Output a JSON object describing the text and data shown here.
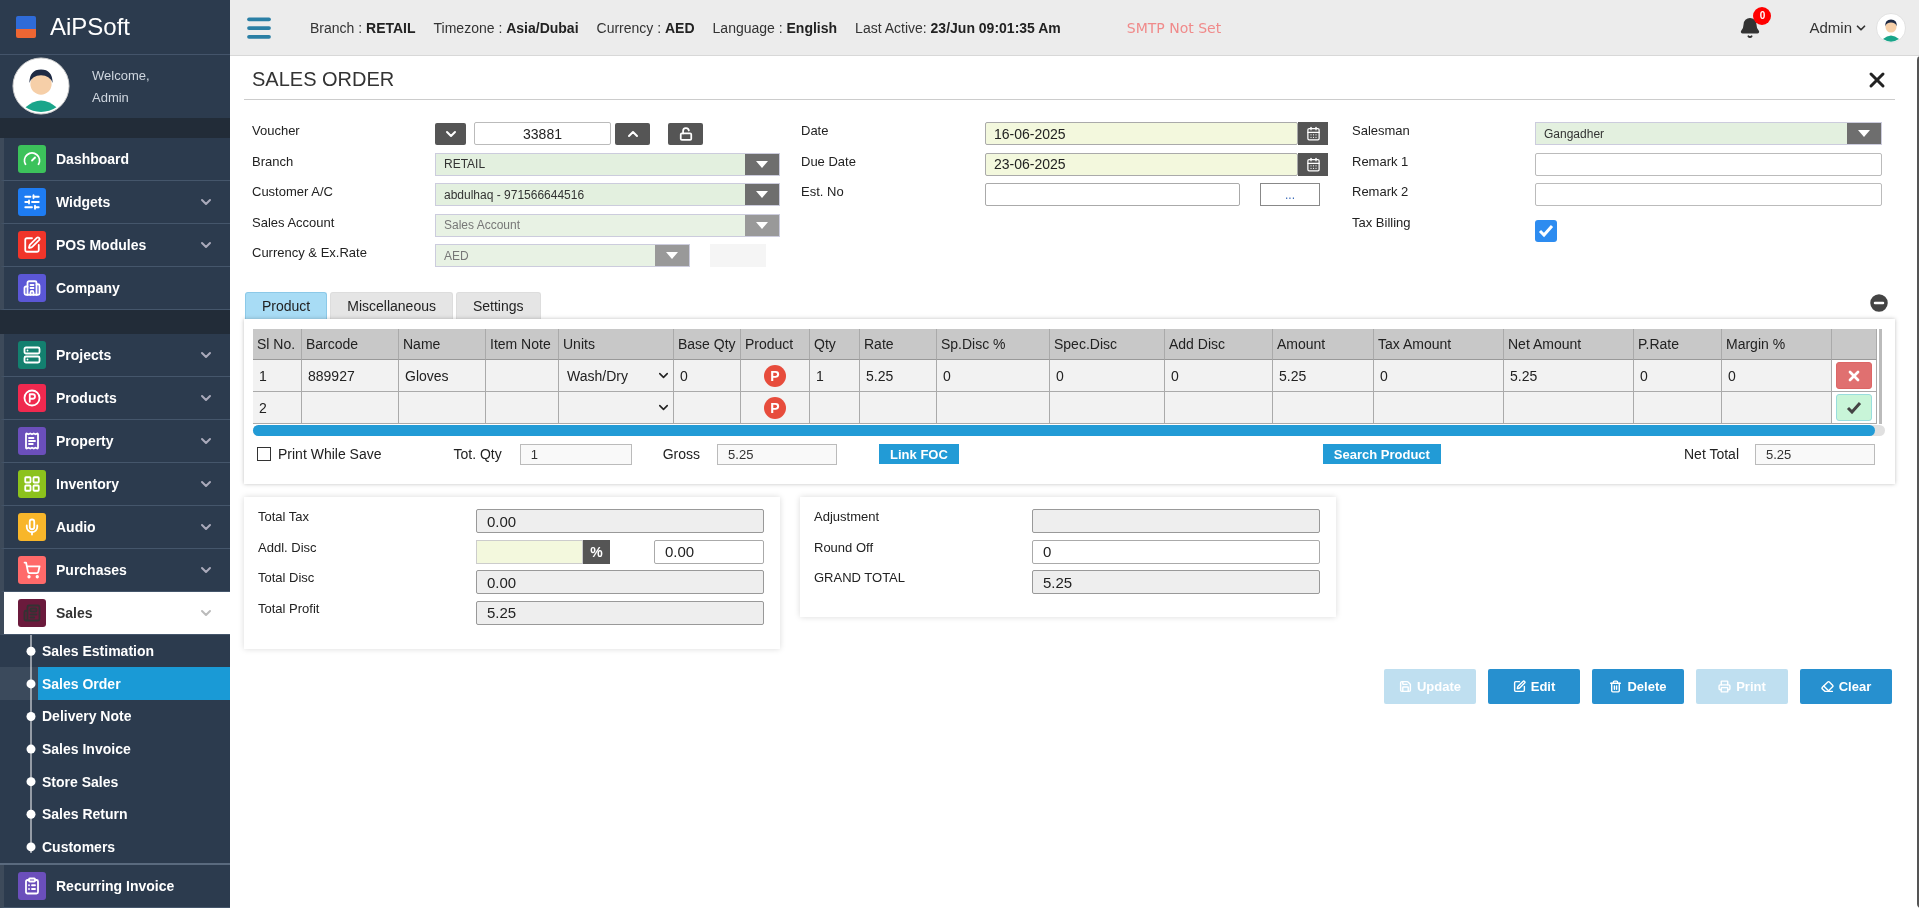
{
  "sidebar": {
    "brand": "AiPSoft",
    "welcome": "Welcome,",
    "user": "Admin",
    "groups": [
      {
        "items": [
          {
            "label": "Dashboard",
            "color": "#3cc25b",
            "expandable": false,
            "expanded": false
          },
          {
            "label": "Widgets",
            "color": "#1e7cf2",
            "expandable": true,
            "expanded": false
          },
          {
            "label": "POS Modules",
            "color": "#f0352a",
            "expandable": true,
            "expanded": false
          },
          {
            "label": "Company",
            "color": "#5b57d6",
            "expandable": false,
            "expanded": false
          }
        ]
      },
      {
        "items": [
          {
            "label": "Projects",
            "color": "#13806f",
            "expandable": true,
            "expanded": false
          },
          {
            "label": "Products",
            "color": "#f0294f",
            "expandable": true,
            "expanded": false
          },
          {
            "label": "Property",
            "color": "#6b4fbb",
            "expandable": true,
            "expanded": false
          },
          {
            "label": "Inventory",
            "color": "#8cc21c",
            "expandable": true,
            "expanded": false
          },
          {
            "label": "Audio",
            "color": "#f8b62a",
            "expandable": true,
            "expanded": false
          },
          {
            "label": "Purchases",
            "color": "#ff6a6a",
            "expandable": true,
            "expanded": false
          },
          {
            "label": "Sales",
            "color": "#6b1a3c",
            "expandable": true,
            "expanded": true,
            "children": [
              {
                "label": "Sales Estimation",
                "selected": false
              },
              {
                "label": "Sales Order",
                "selected": true
              },
              {
                "label": "Delivery Note",
                "selected": false
              },
              {
                "label": "Sales Invoice",
                "selected": false
              },
              {
                "label": "Store Sales",
                "selected": false
              },
              {
                "label": "Sales Return",
                "selected": false
              },
              {
                "label": "Customers",
                "selected": false
              }
            ]
          },
          {
            "label": "Recurring Invoice",
            "color": "#6b4fbb",
            "expandable": false,
            "expanded": false
          }
        ]
      }
    ]
  },
  "topbar": {
    "info": [
      "Branch : **RETAIL**",
      "Timezone : **Asia/Dubai**",
      "Currency : **AED**",
      "Language : **English**",
      "Last Active: **23/Jun 09:01:35 Am**"
    ],
    "smtp": "SMTP Not Set",
    "notifications": "0",
    "user": "Admin"
  },
  "page": {
    "title": "SALES ORDER"
  },
  "form": {
    "columns": [
      {
        "fields": [
          {
            "kind": "voucher",
            "label": "Voucher",
            "value": "33881"
          },
          {
            "kind": "select",
            "label": "Branch",
            "value": "RETAIL",
            "disabled": false
          },
          {
            "kind": "select",
            "label": "Customer A/C",
            "value": "abdulhaq - 971566644516",
            "disabled": false
          },
          {
            "kind": "select",
            "label": "Sales Account",
            "placeholder": "Sales Account",
            "disabled": true
          },
          {
            "kind": "rate",
            "label": "Currency & Ex.Rate",
            "value": "AED",
            "disabled": true
          }
        ]
      },
      {
        "fields": [
          {
            "kind": "date",
            "label": "Date",
            "value": "16-06-2025"
          },
          {
            "kind": "date",
            "label": "Due Date",
            "value": "23-06-2025"
          },
          {
            "kind": "lookup",
            "label": "Est. No",
            "button": "..."
          }
        ]
      },
      {
        "fields": [
          {
            "kind": "select",
            "label": "Salesman",
            "value": "Gangadher",
            "disabled": false
          },
          {
            "kind": "text",
            "label": "Remark 1"
          },
          {
            "kind": "text",
            "label": "Remark 2"
          },
          {
            "kind": "checkbox",
            "label": "Tax Billing",
            "checked": true
          }
        ]
      }
    ]
  },
  "tabs": [
    {
      "label": "Product",
      "selected": true
    },
    {
      "label": "Miscellaneous",
      "selected": false
    },
    {
      "label": "Settings",
      "selected": false
    }
  ],
  "table": {
    "columns": [
      "Sl No.",
      "Barcode",
      "Name",
      "Item Note",
      "Units",
      "Base Qty",
      "Product",
      "Qty",
      "Rate",
      "Sp.Disc %",
      "Spec.Disc",
      "Add Disc",
      "Amount",
      "Tax Amount",
      "Net Amount",
      "P.Rate",
      "Margin %"
    ],
    "rows": [
      {
        "cells": [
          "1",
          "889927",
          "Gloves",
          "",
          "Wash/Dry",
          "0",
          "P",
          "1",
          "5.25",
          "0",
          "0",
          "0",
          "5.25",
          "0",
          "5.25",
          "0",
          "0"
        ],
        "kind": "delete"
      },
      {
        "cells": [
          "2",
          "",
          "",
          "",
          "",
          "",
          "P",
          "",
          "",
          "",
          "",
          "",
          "",
          "",
          "",
          "",
          ""
        ],
        "kind": "confirm"
      }
    ]
  },
  "table_footer": {
    "print_while_save": {
      "label": "Print While Save",
      "checked": false
    },
    "tot_qty": {
      "label": "Tot. Qty",
      "value": "1"
    },
    "gross": {
      "label": "Gross",
      "value": "5.25"
    },
    "link_foc": "Link FOC",
    "search_product": "Search Product",
    "net_total": {
      "label": "Net Total",
      "value": "5.25"
    }
  },
  "summary": {
    "left": [
      {
        "kind": "readonly",
        "label": "Total Tax",
        "value": "0.00"
      },
      {
        "kind": "discount",
        "label": "Addl. Disc",
        "unit": "%",
        "value": "0.00"
      },
      {
        "kind": "readonly",
        "label": "Total Disc",
        "value": "0.00"
      },
      {
        "kind": "readonly",
        "label": "Total Profit",
        "value": "5.25"
      }
    ],
    "right": [
      {
        "kind": "readonly",
        "label": "Adjustment"
      },
      {
        "kind": "input",
        "label": "Round Off",
        "value": "0"
      },
      {
        "kind": "readonly",
        "label": "GRAND TOTAL",
        "value": "5.25"
      }
    ]
  },
  "actions": [
    {
      "kind": "save",
      "label": "Update",
      "disabled": true
    },
    {
      "kind": "edit",
      "label": "Edit",
      "disabled": false
    },
    {
      "kind": "delete",
      "label": "Delete",
      "disabled": false
    },
    {
      "kind": "print",
      "label": "Print",
      "disabled": true
    },
    {
      "kind": "clear",
      "label": "Clear",
      "disabled": false
    }
  ]
}
